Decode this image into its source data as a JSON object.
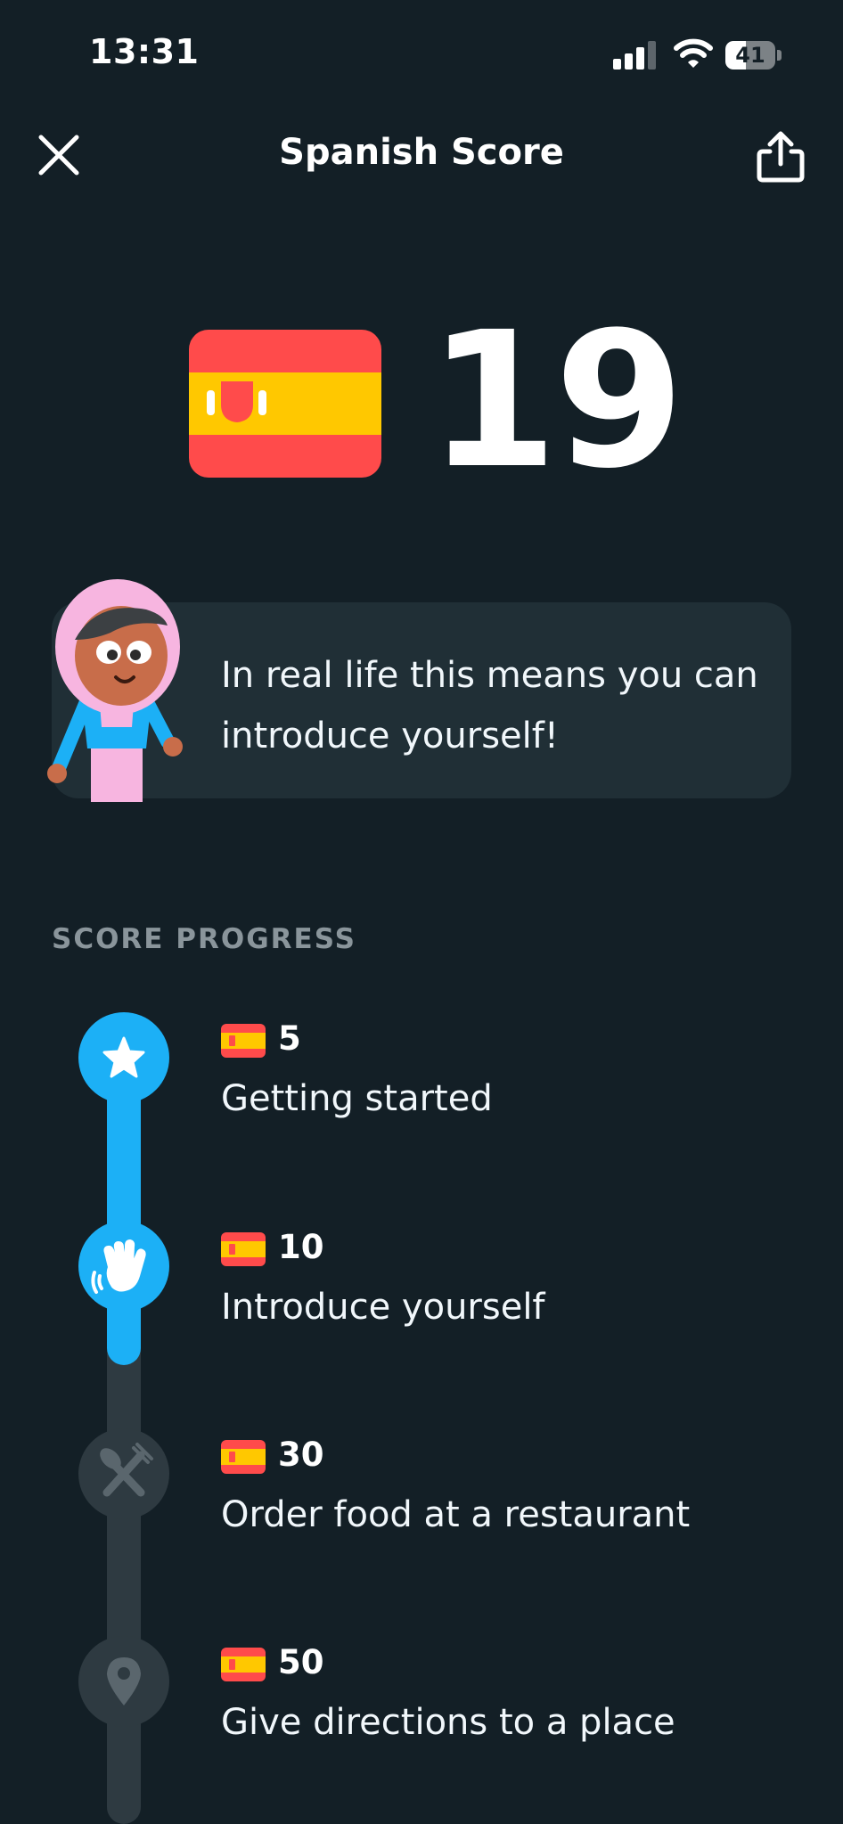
{
  "status_bar": {
    "time": "13:31",
    "battery_level": "41",
    "battery_fraction": 0.41
  },
  "header": {
    "title": "Spanish Score"
  },
  "score": {
    "value": "19",
    "language": "Spanish"
  },
  "card": {
    "message": "In real life this means you can introduce yourself!"
  },
  "progress": {
    "section_label": "SCORE PROGRESS",
    "completed_fraction": 0.55,
    "milestones": [
      {
        "score": "5",
        "title": "Getting started",
        "icon": "star-icon",
        "status": "completed"
      },
      {
        "score": "10",
        "title": "Introduce yourself",
        "icon": "waving-hand-icon",
        "status": "completed"
      },
      {
        "score": "30",
        "title": "Order food at a restaurant",
        "icon": "fork-knife-icon",
        "status": "locked"
      },
      {
        "score": "50",
        "title": "Give directions to a place",
        "icon": "location-pin-icon",
        "status": "locked"
      }
    ]
  },
  "colors": {
    "background": "#131f26",
    "card": "#202f36",
    "accent": "#1cb0f6",
    "locked": "#2e3a41",
    "muted_text": "#8a959b"
  }
}
